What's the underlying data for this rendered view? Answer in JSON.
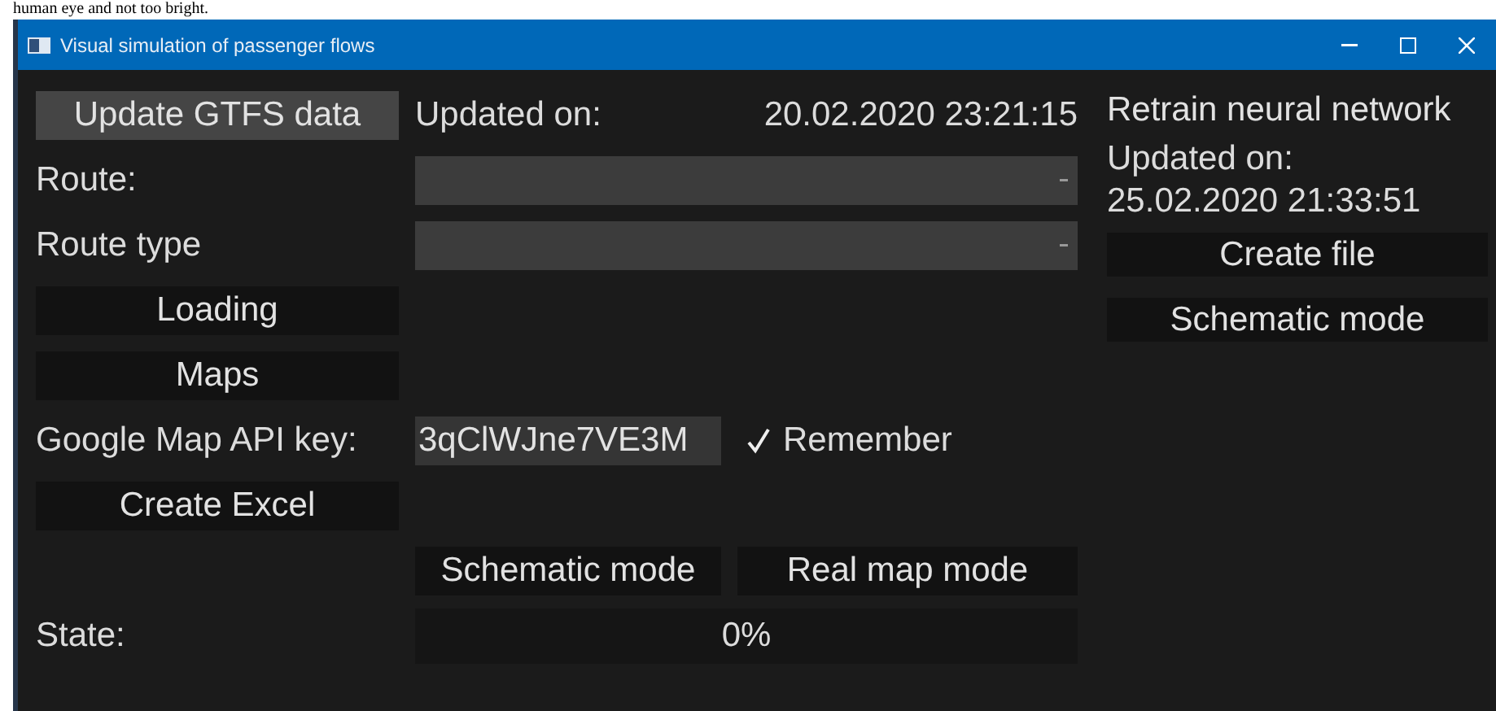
{
  "page_text": "human eye and not too bright.",
  "window": {
    "title": "Visual simulation of passenger flows"
  },
  "gtfs": {
    "button": "Update GTFS data",
    "updated_label": "Updated on:",
    "updated_value": "20.02.2020 23:21:15"
  },
  "route": {
    "label": "Route:"
  },
  "route_type": {
    "label": "Route type"
  },
  "left_buttons": [
    "Loading",
    "Maps"
  ],
  "api_key": {
    "label": "Google Map API key:",
    "value": "3qClWJne7VE3M",
    "remember": {
      "label": "Remember",
      "checked": true
    }
  },
  "excel_button": "Create Excel",
  "modes": [
    {
      "label": "Schematic mode"
    },
    {
      "label": "Real map mode"
    }
  ],
  "state": {
    "label": "State:",
    "level": 0,
    "reading": "0%"
  },
  "neural": {
    "button": "Retrain neural network",
    "updated_label": "Updated on:",
    "updated_value": "25.02.2020 21:33:51",
    "buttons": [
      "Create file",
      "Schematic mode"
    ]
  }
}
